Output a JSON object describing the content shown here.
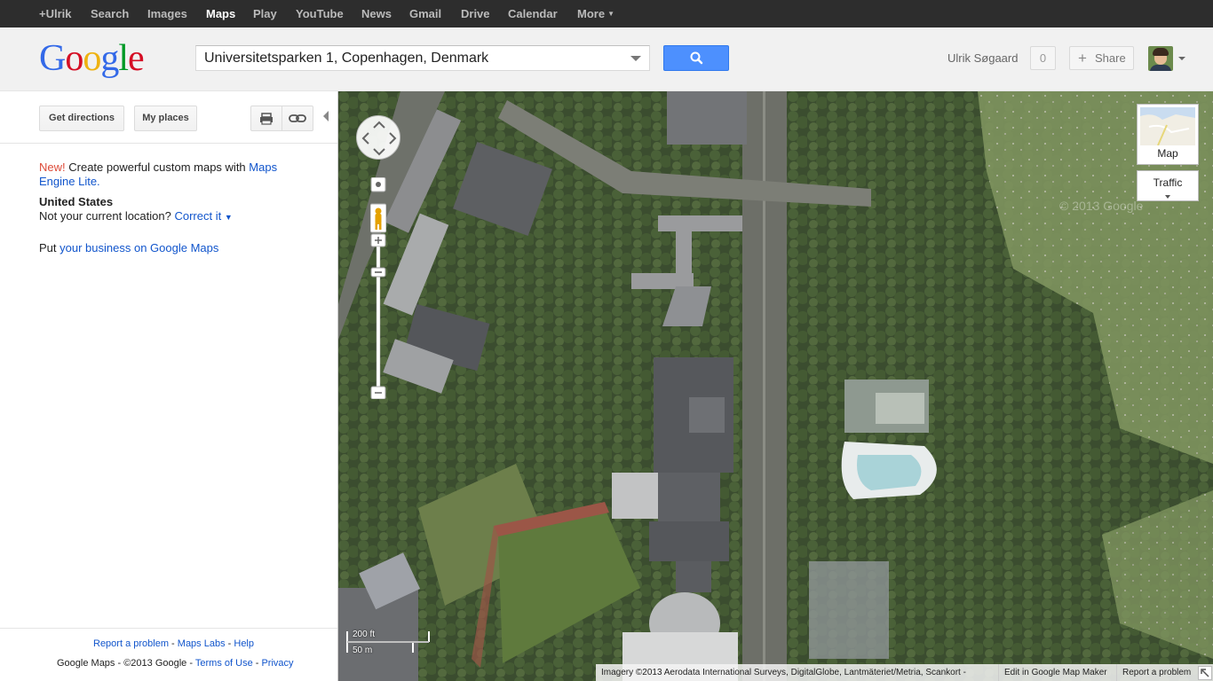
{
  "topbar": {
    "items": [
      "+Ulrik",
      "Search",
      "Images",
      "Maps",
      "Play",
      "YouTube",
      "News",
      "Gmail",
      "Drive",
      "Calendar",
      "More"
    ],
    "active": "Maps"
  },
  "header": {
    "logo": "Google",
    "search_value": "Universitetsparken 1, Copenhagen, Denmark",
    "username": "Ulrik Søgaard",
    "notifications": "0",
    "share_label": "Share"
  },
  "leftpanel": {
    "directions_label": "Get directions",
    "myplaces_label": "My places",
    "promo_new": "New!",
    "promo_text": "Create powerful custom maps with",
    "promo_link1": "Maps",
    "promo_link2": "Engine Lite.",
    "location_title": "United States",
    "location_question": "Not your current location?",
    "location_correct": "Correct it",
    "business_prefix": "Put",
    "business_link": "your business on Google Maps",
    "footer": {
      "report_problem": "Report a problem",
      "sep": " - ",
      "maps_labs": "Maps Labs",
      "help": "Help",
      "copyright": "Google Maps - ©2013 Google - ",
      "terms": "Terms of Use",
      "privacy": "Privacy"
    }
  },
  "map": {
    "maptype_label": "Map",
    "traffic_label": "Traffic",
    "scale_ft": "200 ft",
    "scale_m": "50 m",
    "attribution": "Imagery ©2013 Aerodata International Surveys, DigitalGlobe, Lantmäteriet/Metria, Scankort -",
    "edit_link": "Edit in Google Map Maker",
    "report_link": "Report a problem",
    "watermark": "© 2013 Google"
  },
  "colors": {
    "search_button": "#4d90fe",
    "link": "#1155cc",
    "new_red": "#dd4b39",
    "topbar": "#2d2d2d"
  }
}
